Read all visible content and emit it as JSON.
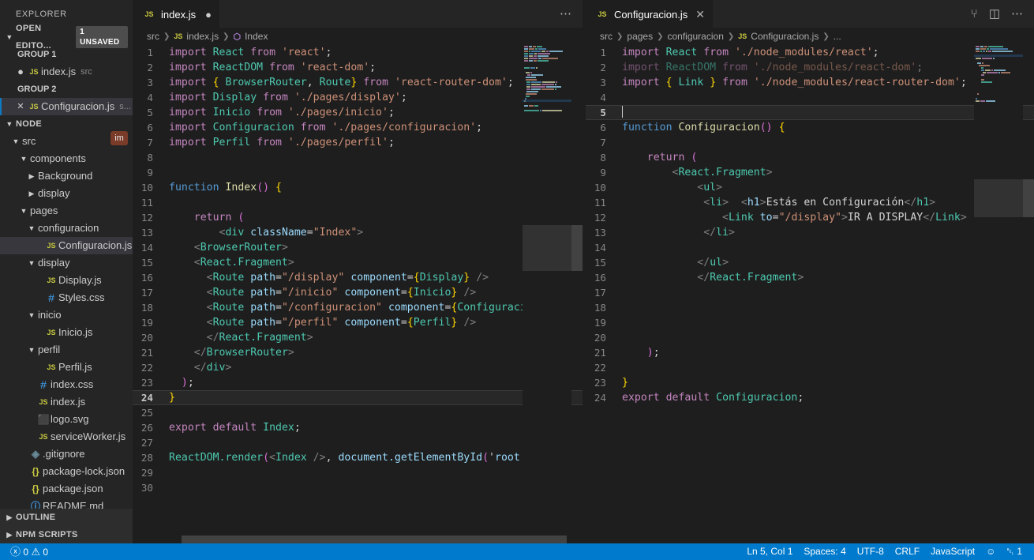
{
  "sidebar": {
    "title": "EXPLORER",
    "open_editors": {
      "label": "OPEN EDITO...",
      "badge": "1 UNSAVED",
      "groups": [
        {
          "label": "GROUP 1",
          "items": [
            {
              "state": "dirty",
              "icon": "js-file-icon",
              "icon_text": "JS",
              "name": "index.js",
              "desc": "src",
              "active": false
            }
          ]
        },
        {
          "label": "GROUP 2",
          "items": [
            {
              "state": "close",
              "icon": "js-file-icon",
              "icon_text": "JS",
              "name": "Configuracion.js",
              "desc": "s...",
              "active": true
            }
          ]
        }
      ]
    },
    "node_section": {
      "label": "NODE"
    },
    "tree": [
      {
        "depth": 1,
        "twisty": "down",
        "icon": "",
        "icon_text": "",
        "name": "src",
        "kind": "folder",
        "selected": false
      },
      {
        "depth": 2,
        "twisty": "down",
        "icon": "",
        "icon_text": "",
        "name": "components",
        "kind": "folder",
        "selected": false
      },
      {
        "depth": 3,
        "twisty": "right",
        "icon": "",
        "icon_text": "",
        "name": "Background",
        "kind": "folder",
        "selected": false
      },
      {
        "depth": 3,
        "twisty": "right",
        "icon": "",
        "icon_text": "",
        "name": "display",
        "kind": "folder",
        "selected": false
      },
      {
        "depth": 2,
        "twisty": "down",
        "icon": "",
        "icon_text": "",
        "name": "pages",
        "kind": "folder",
        "selected": false
      },
      {
        "depth": 3,
        "twisty": "down",
        "icon": "",
        "icon_text": "",
        "name": "configuracion",
        "kind": "folder",
        "selected": false
      },
      {
        "depth": 4,
        "twisty": "none",
        "icon": "js-file-icon",
        "icon_text": "JS",
        "name": "Configuracion.js",
        "kind": "file",
        "selected": true
      },
      {
        "depth": 3,
        "twisty": "down",
        "icon": "",
        "icon_text": "",
        "name": "display",
        "kind": "folder",
        "selected": false
      },
      {
        "depth": 4,
        "twisty": "none",
        "icon": "js-file-icon",
        "icon_text": "JS",
        "name": "Display.js",
        "kind": "file",
        "selected": false
      },
      {
        "depth": 4,
        "twisty": "none",
        "icon": "css-file-icon",
        "icon_text": "#",
        "name": "Styles.css",
        "kind": "file",
        "selected": false
      },
      {
        "depth": 3,
        "twisty": "down",
        "icon": "",
        "icon_text": "",
        "name": "inicio",
        "kind": "folder",
        "selected": false
      },
      {
        "depth": 4,
        "twisty": "none",
        "icon": "js-file-icon",
        "icon_text": "JS",
        "name": "Inicio.js",
        "kind": "file",
        "selected": false
      },
      {
        "depth": 3,
        "twisty": "down",
        "icon": "",
        "icon_text": "",
        "name": "perfil",
        "kind": "folder",
        "selected": false
      },
      {
        "depth": 4,
        "twisty": "none",
        "icon": "js-file-icon",
        "icon_text": "JS",
        "name": "Perfil.js",
        "kind": "file",
        "selected": false
      },
      {
        "depth": 3,
        "twisty": "none",
        "icon": "css-file-icon",
        "icon_text": "#",
        "name": "index.css",
        "kind": "file",
        "selected": false
      },
      {
        "depth": 3,
        "twisty": "none",
        "icon": "js-file-icon",
        "icon_text": "JS",
        "name": "index.js",
        "kind": "file",
        "selected": false
      },
      {
        "depth": 3,
        "twisty": "none",
        "icon": "svg-file-icon",
        "icon_text": "⬛",
        "name": "logo.svg",
        "kind": "file",
        "selected": false
      },
      {
        "depth": 3,
        "twisty": "none",
        "icon": "js-file-icon",
        "icon_text": "JS",
        "name": "serviceWorker.js",
        "kind": "file",
        "selected": false
      },
      {
        "depth": 2,
        "twisty": "none",
        "icon": "git-file-icon",
        "icon_text": "◈",
        "name": ".gitignore",
        "kind": "file",
        "selected": false
      },
      {
        "depth": 2,
        "twisty": "none",
        "icon": "json-file-icon",
        "icon_text": "{}",
        "name": "package-lock.json",
        "kind": "file",
        "selected": false
      },
      {
        "depth": 2,
        "twisty": "none",
        "icon": "json-file-icon",
        "icon_text": "{}",
        "name": "package.json",
        "kind": "file",
        "selected": false
      },
      {
        "depth": 2,
        "twisty": "none",
        "icon": "md-file-icon",
        "icon_text": "ⓘ",
        "name": "README.md",
        "kind": "file",
        "selected": false
      }
    ],
    "overlay_badge": "im",
    "bottom_sections": [
      {
        "label": "OUTLINE"
      },
      {
        "label": "NPM SCRIPTS"
      }
    ]
  },
  "left_editor": {
    "tab": {
      "icon_text": "JS",
      "label": "index.js",
      "dirty": true
    },
    "actions": {
      "more": "⋯"
    },
    "breadcrumbs": [
      {
        "text": "src",
        "icon": ""
      },
      {
        "text": "index.js",
        "icon": "JS"
      },
      {
        "text": "Index",
        "icon": "⬡"
      }
    ],
    "current_line": 24,
    "lines": [
      {
        "n": 1
      },
      {
        "n": 2
      },
      {
        "n": 3
      },
      {
        "n": 4
      },
      {
        "n": 5
      },
      {
        "n": 6
      },
      {
        "n": 7
      },
      {
        "n": 8
      },
      {
        "n": 9
      },
      {
        "n": 10
      },
      {
        "n": 11
      },
      {
        "n": 12
      },
      {
        "n": 13
      },
      {
        "n": 14
      },
      {
        "n": 15
      },
      {
        "n": 16
      },
      {
        "n": 17
      },
      {
        "n": 18
      },
      {
        "n": 19
      },
      {
        "n": 20
      },
      {
        "n": 21
      },
      {
        "n": 22
      },
      {
        "n": 23
      },
      {
        "n": 24
      },
      {
        "n": 25
      },
      {
        "n": 26
      },
      {
        "n": 27
      },
      {
        "n": 28
      },
      {
        "n": 29
      },
      {
        "n": 30
      }
    ],
    "source": [
      "import React from 'react';",
      "import ReactDOM from 'react-dom';",
      "import { BrowserRouter, Route} from 'react-router-dom';",
      "import Display from './pages/display';",
      "import Inicio from './pages/inicio';",
      "import Configuracion from './pages/configuracion';",
      "import Perfil from './pages/perfil';",
      "",
      "",
      "function Index() {",
      "",
      "    return (",
      "        <div className=\"Index\">",
      "    <BrowserRouter>",
      "    <React.Fragment>",
      "      <Route path=\"/display\" component={Display} />",
      "      <Route path=\"/inicio\" component={Inicio} />",
      "      <Route path=\"/configuracion\" component={Configuraci",
      "      <Route path=\"/perfil\" component={Perfil} />",
      "      </React.Fragment>",
      "    </BrowserRouter>",
      "    </div>",
      "  );",
      "}",
      "",
      "export default Index;",
      "",
      "ReactDOM.render(<Index />, document.getElementById('root",
      "",
      ""
    ]
  },
  "right_editor": {
    "tab": {
      "icon_text": "JS",
      "label": "Configuracion.js",
      "close": "✕"
    },
    "actions": {
      "split_changes": "⑂",
      "split_editor": "◫",
      "more": "⋯"
    },
    "breadcrumbs": [
      {
        "text": "src",
        "icon": ""
      },
      {
        "text": "pages",
        "icon": ""
      },
      {
        "text": "configuracion",
        "icon": ""
      },
      {
        "text": "Configuracion.js",
        "icon": "JS"
      },
      {
        "text": "...",
        "icon": ""
      }
    ],
    "current_line": 5,
    "lines": [
      {
        "n": 1
      },
      {
        "n": 2
      },
      {
        "n": 3
      },
      {
        "n": 4
      },
      {
        "n": 5
      },
      {
        "n": 6
      },
      {
        "n": 7
      },
      {
        "n": 8
      },
      {
        "n": 9
      },
      {
        "n": 10
      },
      {
        "n": 11
      },
      {
        "n": 12
      },
      {
        "n": 13
      },
      {
        "n": 14
      },
      {
        "n": 15
      },
      {
        "n": 16
      },
      {
        "n": 17
      },
      {
        "n": 18
      },
      {
        "n": 19
      },
      {
        "n": 20
      },
      {
        "n": 21
      },
      {
        "n": 22
      },
      {
        "n": 23
      },
      {
        "n": 24
      }
    ],
    "source": [
      "import React from './node_modules/react';",
      "import ReactDOM from './node_modules/react-dom';",
      "import { Link } from './node_modules/react-router-dom';",
      "",
      "",
      "function Configuracion() {",
      "",
      "    return (",
      "        <React.Fragment>",
      "            <ul>",
      "             <li>  <h1>Estás en Configuración</h1>",
      "                <Link to=\"/display\">IR A DISPLAY</Link>",
      "             </li>",
      "",
      "            </ul>",
      "            </React.Fragment>",
      "",
      "",
      "",
      "",
      "    );",
      "",
      "}",
      "export default Configuracion;"
    ]
  },
  "statusbar": {
    "left": [
      {
        "name": "problems",
        "icon": "ⓧ",
        "text": "0"
      },
      {
        "name": "warnings",
        "icon": "⚠",
        "text": "0"
      }
    ],
    "right": [
      {
        "name": "line-col",
        "text": "Ln 5, Col 1"
      },
      {
        "name": "indentation",
        "text": "Spaces: 4"
      },
      {
        "name": "encoding",
        "text": "UTF-8"
      },
      {
        "name": "eol",
        "text": "CRLF"
      },
      {
        "name": "language-mode",
        "text": "JavaScript"
      },
      {
        "name": "feedback",
        "text": "☺"
      },
      {
        "name": "notifications",
        "text": "␇ 1"
      }
    ]
  },
  "colors": {
    "accent": "#007acc",
    "sidebar_bg": "#252526",
    "editor_bg": "#1e1e1e",
    "tab_inactive": "#2d2d2d",
    "selection": "#37373d",
    "badge_bg": "#7a3b28"
  }
}
